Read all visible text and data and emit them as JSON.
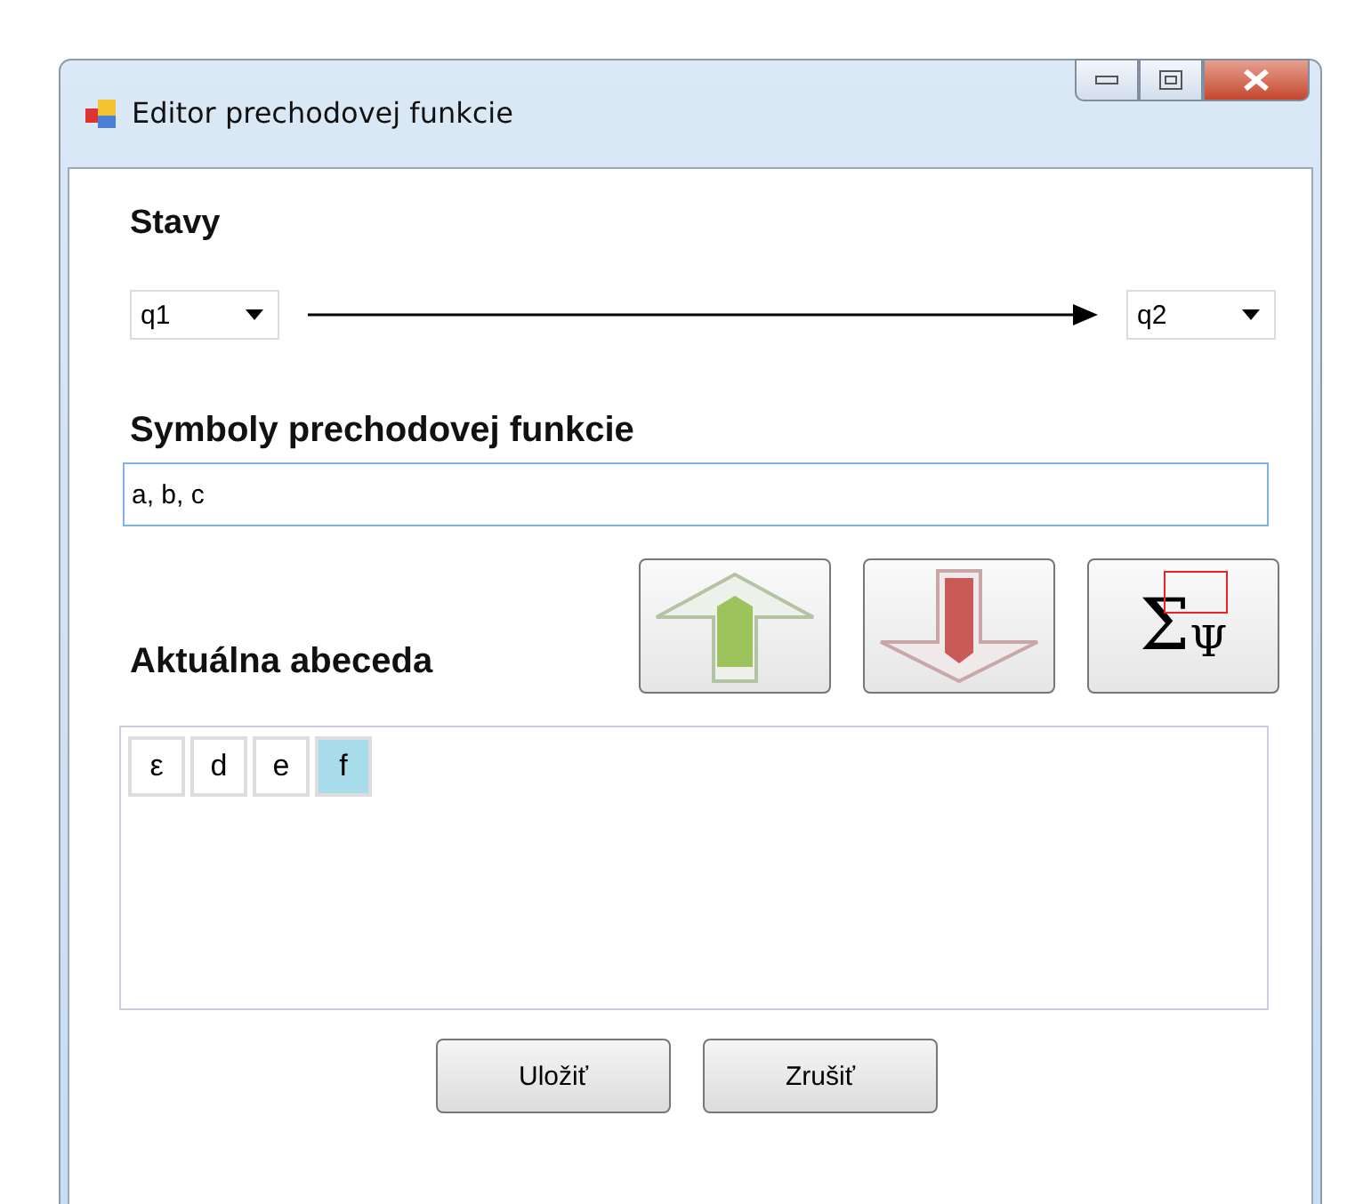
{
  "window": {
    "title": "Editor prechodovej funkcie"
  },
  "states": {
    "label": "Stavy",
    "from": "q1",
    "to": "q2"
  },
  "symbols": {
    "label": "Symboly prechodovej funkcie",
    "value": "a, b, c"
  },
  "alphabet": {
    "label": "Aktuálna abeceda",
    "sigma": "Σ",
    "psi": "Ψ",
    "items": [
      {
        "text": "ε",
        "selected": false
      },
      {
        "text": "d",
        "selected": false
      },
      {
        "text": "e",
        "selected": false
      },
      {
        "text": "f",
        "selected": true
      }
    ]
  },
  "buttons": [
    "Uložiť",
    "Zrušiť"
  ]
}
